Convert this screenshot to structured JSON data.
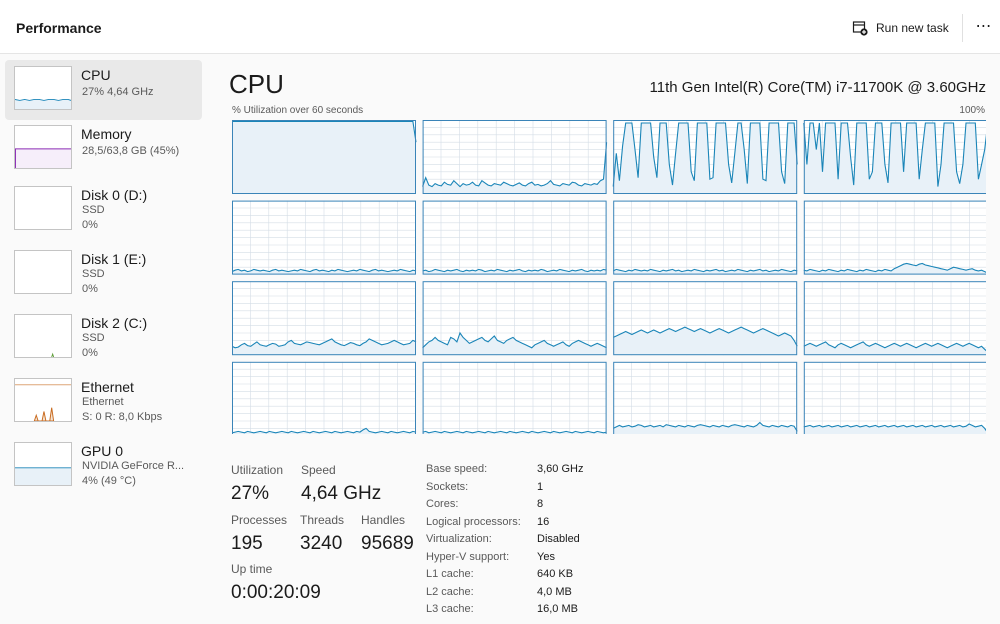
{
  "header": {
    "title": "Performance",
    "run_new_task": "Run new task",
    "more": "⋯"
  },
  "sidebar": {
    "items": [
      {
        "name": "CPU",
        "sub1": "27% 4,64 GHz",
        "sub2": "",
        "selected": true
      },
      {
        "name": "Memory",
        "sub1": "28,5/63,8 GB (45%)",
        "sub2": ""
      },
      {
        "name": "Disk 0 (D:)",
        "sub1": "SSD",
        "sub2": "0%"
      },
      {
        "name": "Disk 1 (E:)",
        "sub1": "SSD",
        "sub2": "0%"
      },
      {
        "name": "Disk 2 (C:)",
        "sub1": "SSD",
        "sub2": "0%"
      },
      {
        "name": "Ethernet",
        "sub1": "Ethernet",
        "sub2": "S: 0 R: 8,0 Kbps"
      },
      {
        "name": "GPU 0",
        "sub1": "NVIDIA GeForce R...",
        "sub2": "4% (49 °C)"
      }
    ]
  },
  "main": {
    "title": "CPU",
    "model": "11th Gen Intel(R) Core(TM) i7-11700K @ 3.60GHz",
    "util_label": "% Utilization over 60 seconds",
    "util_max": "100%",
    "stats": {
      "utilization_label": "Utilization",
      "utilization": "27%",
      "speed_label": "Speed",
      "speed": "4,64 GHz",
      "processes_label": "Processes",
      "processes": "195",
      "threads_label": "Threads",
      "threads": "3240",
      "handles_label": "Handles",
      "handles": "95689",
      "uptime_label": "Up time",
      "uptime": "0:00:20:09"
    },
    "specs": [
      {
        "k": "Base speed:",
        "v": "3,60 GHz"
      },
      {
        "k": "Sockets:",
        "v": "1"
      },
      {
        "k": "Cores:",
        "v": "8"
      },
      {
        "k": "Logical processors:",
        "v": "16"
      },
      {
        "k": "Virtualization:",
        "v": "Disabled"
      },
      {
        "k": "Hyper-V support:",
        "v": "Yes"
      },
      {
        "k": "L1 cache:",
        "v": "640 KB"
      },
      {
        "k": "L2 cache:",
        "v": "4,0 MB"
      },
      {
        "k": "L3 cache:",
        "v": "16,0 MB"
      }
    ]
  },
  "colors": {
    "cpu_line": "#1a85b8",
    "cpu_fill": "#e8f1f8",
    "grid": "#d4dde6",
    "border": "#3a84b8",
    "memory": "#8b2bb5",
    "ethernet": "#c86a1e"
  },
  "chart_data": {
    "type": "line",
    "title": "% Utilization over 60 seconds",
    "ylim": [
      0,
      100
    ],
    "series": [
      {
        "values": [
          98,
          98,
          98,
          98,
          98,
          98,
          98,
          98,
          98,
          98,
          98,
          98,
          98,
          98,
          98,
          98,
          98,
          98,
          98,
          98,
          98,
          98,
          98,
          98,
          98,
          98,
          98,
          98,
          98,
          98,
          98,
          98,
          98,
          98,
          98,
          98,
          98,
          98,
          98,
          98,
          98,
          98,
          98,
          98,
          98,
          98,
          98,
          98,
          98,
          98,
          98,
          98,
          98,
          98,
          98,
          98,
          98,
          98,
          98,
          70
        ]
      },
      {
        "values": [
          10,
          22,
          12,
          10,
          14,
          12,
          11,
          16,
          13,
          12,
          18,
          14,
          10,
          14,
          12,
          13,
          16,
          12,
          11,
          18,
          15,
          12,
          11,
          14,
          13,
          12,
          16,
          14,
          12,
          11,
          13,
          15,
          12,
          11,
          14,
          16,
          12,
          13,
          11,
          12,
          14,
          18,
          13,
          12,
          11,
          14,
          13,
          12,
          16,
          15,
          12,
          11,
          14,
          13,
          12,
          14,
          13,
          18,
          20,
          70
        ]
      },
      {
        "values": [
          10,
          55,
          18,
          65,
          96,
          96,
          96,
          60,
          22,
          96,
          96,
          96,
          96,
          50,
          22,
          96,
          96,
          96,
          40,
          12,
          55,
          96,
          96,
          96,
          96,
          30,
          18,
          96,
          96,
          96,
          96,
          20,
          22,
          96,
          96,
          96,
          96,
          40,
          15,
          55,
          96,
          96,
          60,
          14,
          96,
          96,
          96,
          96,
          20,
          18,
          96,
          96,
          96,
          96,
          30,
          14,
          96,
          96,
          96,
          40
        ]
      },
      {
        "values": [
          96,
          40,
          96,
          96,
          60,
          96,
          30,
          96,
          96,
          96,
          96,
          20,
          96,
          96,
          96,
          50,
          12,
          96,
          96,
          96,
          96,
          20,
          30,
          96,
          96,
          96,
          40,
          15,
          96,
          96,
          96,
          96,
          30,
          96,
          96,
          96,
          96,
          20,
          60,
          96,
          96,
          96,
          96,
          10,
          40,
          96,
          96,
          96,
          96,
          30,
          14,
          40,
          96,
          96,
          96,
          96,
          20,
          40,
          60,
          96
        ]
      },
      {
        "values": [
          4,
          6,
          7,
          5,
          6,
          4,
          5,
          7,
          6,
          5,
          6,
          5,
          4,
          6,
          7,
          5,
          6,
          5,
          4,
          5,
          6,
          5,
          7,
          6,
          5,
          4,
          6,
          7,
          5,
          6,
          5,
          4,
          6,
          5,
          7,
          6,
          5,
          4,
          5,
          6,
          5,
          7,
          6,
          5,
          4,
          6,
          7,
          5,
          6,
          5,
          4,
          5,
          6,
          5,
          7,
          6,
          5,
          4,
          6,
          5
        ]
      },
      {
        "values": [
          5,
          6,
          4,
          5,
          7,
          6,
          5,
          4,
          6,
          5,
          6,
          7,
          5,
          4,
          6,
          5,
          6,
          5,
          7,
          6,
          4,
          5,
          6,
          5,
          7,
          6,
          5,
          4,
          6,
          5,
          6,
          7,
          5,
          4,
          6,
          5,
          6,
          5,
          7,
          6,
          4,
          5,
          6,
          5,
          7,
          6,
          5,
          4,
          6,
          5,
          6,
          7,
          5,
          4,
          6,
          5,
          6,
          5,
          7,
          6
        ]
      },
      {
        "values": [
          5,
          7,
          6,
          5,
          4,
          6,
          5,
          7,
          6,
          5,
          6,
          5,
          7,
          6,
          5,
          4,
          6,
          5,
          6,
          7,
          5,
          6,
          4,
          5,
          6,
          5,
          7,
          6,
          5,
          4,
          6,
          5,
          6,
          7,
          5,
          6,
          4,
          5,
          6,
          5,
          7,
          6,
          5,
          4,
          6,
          5,
          6,
          7,
          5,
          6,
          4,
          5,
          6,
          5,
          7,
          6,
          5,
          4,
          6,
          5
        ]
      },
      {
        "values": [
          6,
          5,
          7,
          6,
          5,
          4,
          6,
          5,
          7,
          6,
          5,
          4,
          6,
          5,
          7,
          6,
          5,
          4,
          6,
          5,
          7,
          6,
          5,
          4,
          6,
          5,
          7,
          6,
          5,
          8,
          10,
          12,
          14,
          15,
          14,
          13,
          12,
          14,
          15,
          13,
          12,
          11,
          10,
          9,
          8,
          7,
          6,
          8,
          10,
          9,
          8,
          7,
          6,
          7,
          8,
          6,
          5,
          6,
          4,
          2
        ]
      },
      {
        "values": [
          12,
          10,
          11,
          14,
          16,
          13,
          12,
          15,
          18,
          14,
          13,
          12,
          14,
          16,
          15,
          12,
          13,
          14,
          18,
          20,
          16,
          15,
          14,
          16,
          18,
          17,
          16,
          15,
          14,
          16,
          18,
          20,
          22,
          18,
          16,
          14,
          13,
          15,
          17,
          16,
          14,
          13,
          16,
          18,
          22,
          20,
          18,
          16,
          14,
          15,
          16,
          18,
          20,
          18,
          16,
          14,
          15,
          16,
          20,
          18
        ]
      },
      {
        "values": [
          10,
          14,
          18,
          20,
          24,
          20,
          18,
          16,
          14,
          24,
          22,
          18,
          30,
          24,
          20,
          16,
          18,
          20,
          22,
          24,
          20,
          18,
          22,
          26,
          20,
          18,
          16,
          20,
          22,
          24,
          20,
          18,
          16,
          14,
          12,
          10,
          14,
          16,
          18,
          20,
          16,
          14,
          12,
          14,
          16,
          18,
          14,
          12,
          16,
          18,
          20,
          18,
          16,
          14,
          12,
          14,
          16,
          14,
          12,
          10
        ]
      },
      {
        "values": [
          24,
          26,
          28,
          30,
          32,
          30,
          28,
          30,
          32,
          34,
          32,
          30,
          32,
          34,
          32,
          30,
          32,
          34,
          36,
          34,
          32,
          34,
          36,
          38,
          36,
          34,
          32,
          34,
          36,
          34,
          32,
          30,
          32,
          34,
          36,
          34,
          32,
          30,
          32,
          34,
          36,
          38,
          36,
          34,
          32,
          30,
          32,
          34,
          36,
          34,
          32,
          30,
          28,
          26,
          28,
          30,
          28,
          26,
          20,
          12
        ]
      },
      {
        "values": [
          12,
          14,
          16,
          14,
          12,
          14,
          16,
          18,
          14,
          12,
          10,
          14,
          16,
          14,
          12,
          10,
          12,
          14,
          16,
          18,
          14,
          12,
          14,
          16,
          14,
          12,
          10,
          12,
          14,
          16,
          14,
          12,
          14,
          16,
          14,
          12,
          10,
          12,
          14,
          16,
          14,
          12,
          14,
          16,
          14,
          12,
          10,
          12,
          14,
          16,
          14,
          12,
          14,
          16,
          14,
          12,
          10,
          12,
          8,
          4
        ]
      },
      {
        "values": [
          4,
          5,
          6,
          5,
          4,
          6,
          5,
          4,
          5,
          6,
          5,
          4,
          6,
          5,
          4,
          5,
          6,
          5,
          4,
          6,
          5,
          4,
          5,
          6,
          5,
          4,
          6,
          5,
          4,
          5,
          6,
          5,
          4,
          6,
          5,
          4,
          5,
          6,
          5,
          4,
          6,
          5,
          8,
          10,
          6,
          5,
          4,
          5,
          6,
          5,
          4,
          6,
          5,
          4,
          5,
          6,
          5,
          4,
          6,
          5
        ]
      },
      {
        "values": [
          5,
          6,
          4,
          5,
          6,
          5,
          4,
          6,
          5,
          4,
          5,
          6,
          5,
          4,
          6,
          5,
          4,
          5,
          6,
          5,
          4,
          6,
          5,
          4,
          5,
          6,
          5,
          4,
          6,
          5,
          4,
          5,
          6,
          5,
          4,
          6,
          5,
          4,
          5,
          6,
          5,
          4,
          6,
          5,
          4,
          5,
          6,
          5,
          4,
          6,
          5,
          4,
          5,
          6,
          5,
          4,
          6,
          5,
          4,
          5
        ]
      },
      {
        "values": [
          10,
          12,
          14,
          12,
          13,
          14,
          12,
          13,
          15,
          14,
          12,
          13,
          14,
          12,
          13,
          14,
          12,
          15,
          14,
          13,
          12,
          14,
          13,
          12,
          14,
          13,
          12,
          14,
          15,
          14,
          13,
          12,
          14,
          13,
          12,
          14,
          13,
          12,
          14,
          15,
          14,
          13,
          12,
          14,
          13,
          12,
          14,
          18,
          14,
          13,
          12,
          14,
          13,
          12,
          14,
          13,
          12,
          14,
          13,
          6
        ]
      },
      {
        "values": [
          12,
          13,
          14,
          12,
          13,
          14,
          12,
          13,
          14,
          12,
          13,
          14,
          12,
          13,
          14,
          12,
          13,
          14,
          12,
          13,
          14,
          12,
          13,
          14,
          12,
          13,
          14,
          12,
          13,
          14,
          12,
          13,
          14,
          12,
          13,
          14,
          12,
          13,
          14,
          12,
          13,
          14,
          12,
          13,
          14,
          12,
          13,
          14,
          12,
          13,
          14,
          12,
          13,
          16,
          14,
          12,
          13,
          14,
          10,
          4
        ]
      }
    ]
  }
}
